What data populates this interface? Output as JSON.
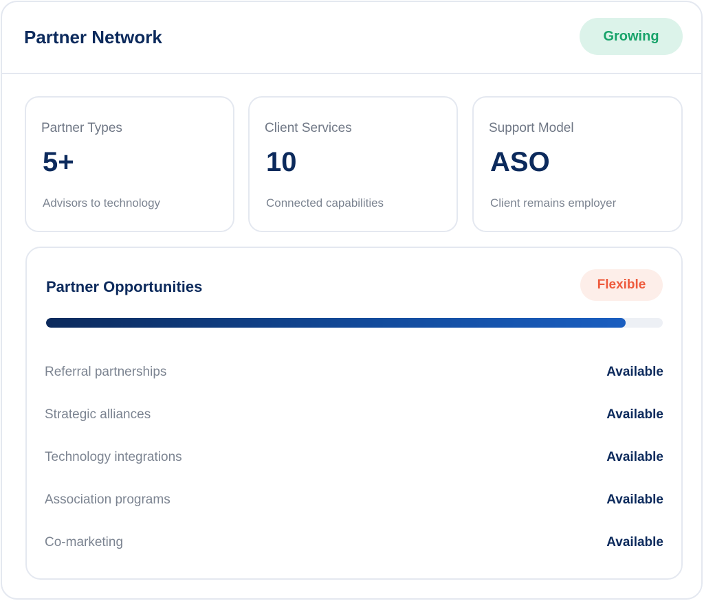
{
  "header": {
    "title": "Partner Network",
    "badge": "Growing"
  },
  "stats": [
    {
      "label": "Partner Types",
      "value": "5+",
      "sub": "Advisors to technology"
    },
    {
      "label": "Client Services",
      "value": "10",
      "sub": "Connected capabilities"
    },
    {
      "label": "Support Model",
      "value": "ASO",
      "sub": "Client remains employer"
    }
  ],
  "opportunities": {
    "title": "Partner Opportunities",
    "badge": "Flexible",
    "progress_percent": 94,
    "items": [
      {
        "label": "Referral partnerships",
        "status": "Available"
      },
      {
        "label": "Strategic alliances",
        "status": "Available"
      },
      {
        "label": "Technology integrations",
        "status": "Available"
      },
      {
        "label": "Association programs",
        "status": "Available"
      },
      {
        "label": "Co-marketing",
        "status": "Available"
      }
    ]
  },
  "colors": {
    "brand_navy": "#0c2a5c",
    "growing_green": "#18a36a",
    "flexible_orange": "#ee5a3c"
  }
}
